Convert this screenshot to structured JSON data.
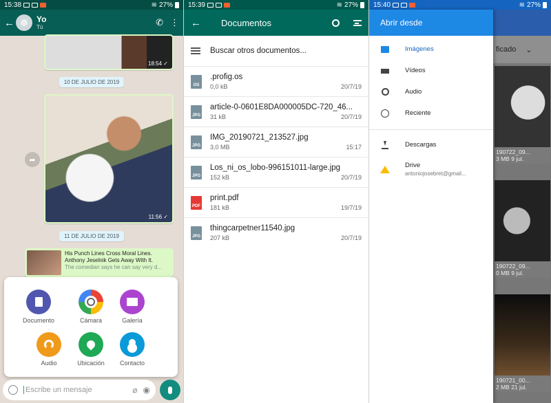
{
  "whatsapp": {
    "status_time": "15:38",
    "battery": "27%",
    "contact_name": "Yo",
    "contact_sub": "Tú",
    "image1_time": "18:54 ✓",
    "date1": "10 DE JULIO DE 2019",
    "image2_time": "11:56 ✓",
    "date2": "11 DE JULIO DE 2019",
    "link_title": "His Punch Lines Cross Moral Lines. Anthony Jeselnik Gets Away With It.",
    "link_sub": "The comedian says he can say very d...",
    "attach": [
      {
        "label": "Documento"
      },
      {
        "label": "Cámara"
      },
      {
        "label": "Galería"
      },
      {
        "label": "Audio"
      },
      {
        "label": "Ubicación"
      },
      {
        "label": "Contacto"
      }
    ],
    "compose_placeholder": "Escribe un mensaje"
  },
  "documents": {
    "status_time": "15:39",
    "battery": "27%",
    "title": "Documentos",
    "search_row": "Buscar otros documentos...",
    "files": [
      {
        "type": "OS",
        "name": ".profig.os",
        "size": "0,0 kB",
        "date": "20/7/19"
      },
      {
        "type": "JPG",
        "name": "article-0-0601E8DA000005DC-720_46...",
        "size": "31 kB",
        "date": "20/7/19"
      },
      {
        "type": "JPG",
        "name": "IMG_20190721_213527.jpg",
        "size": "3,0 MB",
        "date": "15:17"
      },
      {
        "type": "JPG",
        "name": "Los_ni_os_lobo-996151011-large.jpg",
        "size": "152 kB",
        "date": "20/7/19"
      },
      {
        "type": "PDF",
        "name": "print.pdf",
        "size": "181 kB",
        "date": "19/7/19"
      },
      {
        "type": "JPG",
        "name": "thingcarpetner11540.jpg",
        "size": "207 kB",
        "date": "20/7/19"
      }
    ]
  },
  "opener": {
    "status_time": "15:40",
    "battery": "27%",
    "drawer_title": "Abrir desde",
    "items": [
      {
        "label": "Imágenes",
        "icon": "image-icon"
      },
      {
        "label": "Vídeos",
        "icon": "video-icon"
      },
      {
        "label": "Audio",
        "icon": "audio-icon"
      },
      {
        "label": "Reciente",
        "icon": "clock-icon"
      }
    ],
    "downloads": "Descargas",
    "drive_label": "Drive",
    "drive_account": "antoniojosebret@gmail...",
    "bg_row_text": "ficado",
    "thumbs": [
      {
        "name": "190722_09...",
        "size": "3 MB 9 jul."
      },
      {
        "name": "190722_09...",
        "size": "0 MB 9 jul."
      },
      {
        "name": "190721_00...",
        "size": "2 MB 21 jul."
      }
    ]
  }
}
